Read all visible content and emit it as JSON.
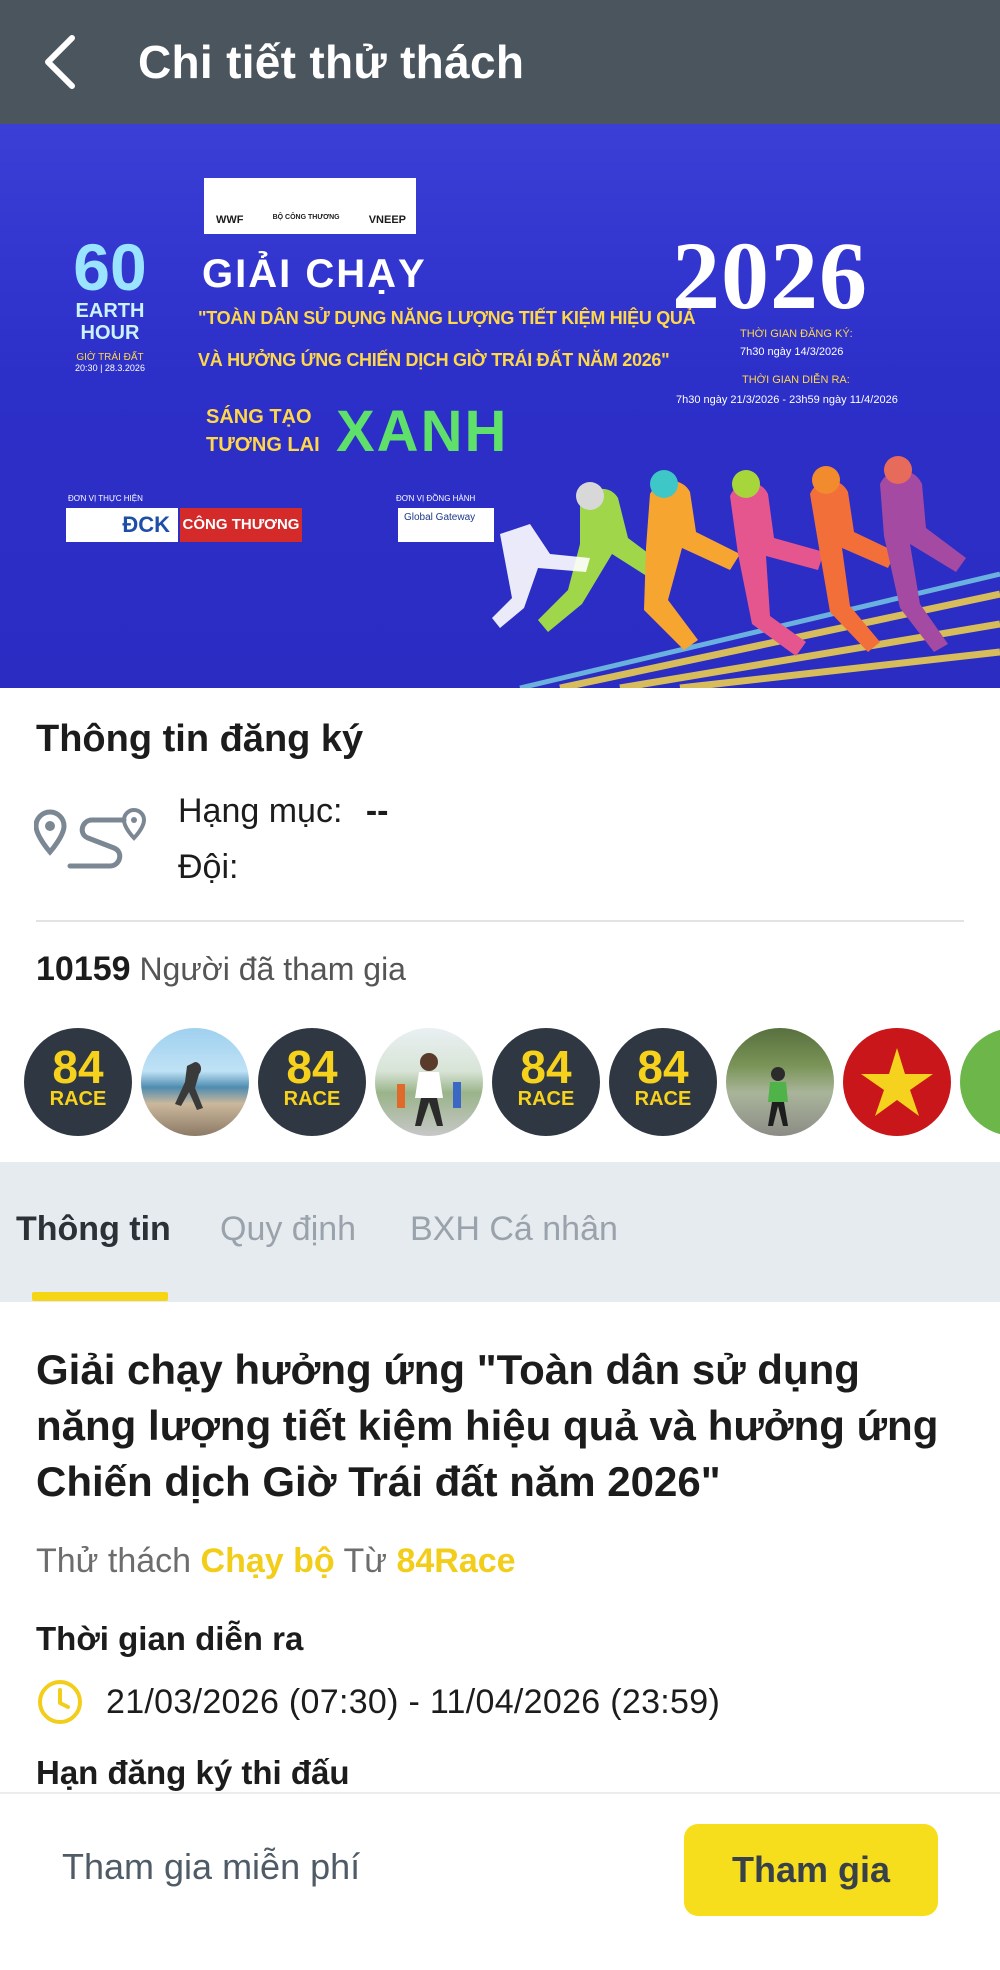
{
  "header": {
    "title": "Chi tiết thử thách",
    "back_icon": "chevron-left-icon"
  },
  "banner": {
    "partner_logos": [
      "WWF",
      "BỘ CÔNG THƯƠNG",
      "VNEEP"
    ],
    "earth_hour": {
      "number": "60",
      "line1": "EARTH",
      "line2": "HOUR",
      "vn_label": "GIỜ TRÁI ĐẤT",
      "date": "20:30 | 28.3.2026"
    },
    "heading": "GIẢI CHẠY",
    "slogan_line1": "\"TOÀN DÂN SỬ DỤNG NĂNG LƯỢNG TIẾT KIỆM HIỆU QUẢ",
    "slogan_line2": "VÀ HƯỞNG ỨNG CHIẾN DỊCH GIỜ TRÁI ĐẤT NĂM 2026\"",
    "tagline_small1": "SÁNG TẠO",
    "tagline_small2": "TƯƠNG LAI",
    "tagline_big": "XANH",
    "year": "2026",
    "reg_label": "THỜI GIAN ĐĂNG KÝ:",
    "reg_value": "7h30 ngày 14/3/2026",
    "run_label": "THỜI GIAN DIỄN RA:",
    "run_value": "7h30 ngày 21/3/2026 - 23h59 ngày 11/4/2026",
    "organizer_label": "ĐƠN VỊ THỰC HIỆN",
    "organizer1": "ĐCK",
    "organizer2": "CÔNG THƯƠNG",
    "companion_label": "ĐƠN VỊ ĐỒNG HÀNH",
    "companion": "Global Gateway"
  },
  "registration": {
    "title": "Thông tin đăng ký",
    "category_label": "Hạng mục:",
    "category_value": "--",
    "team_label": "Đội:",
    "route_icon": "route-pin-icon"
  },
  "participants": {
    "count": "10159",
    "label": "Người đã tham gia",
    "avatar_text_top": "84",
    "avatar_text_bottom": "RACE"
  },
  "tabs": [
    {
      "label": "Thông tin",
      "active": true
    },
    {
      "label": "Quy định",
      "active": false
    },
    {
      "label": "BXH Cá nhân",
      "active": false
    }
  ],
  "event": {
    "title": "Giải chạy hưởng ứng \"Toàn dân sử dụng năng lượng tiết kiệm hiệu quả và hưởng ứng Chiến dịch Giờ Trái đất năm 2026\"",
    "type_prefix": "Thử thách",
    "type_value": "Chạy bộ",
    "from_prefix": "Từ",
    "from_value": "84Race",
    "time_heading": "Thời gian diễn ra",
    "time_value": "21/03/2026 (07:30) - 11/04/2026 (23:59)",
    "deadline_heading": "Hạn đăng ký thi đấu"
  },
  "bottom": {
    "free_label": "Tham gia miễn phí",
    "join_label": "Tham gia"
  },
  "colors": {
    "header_bg": "#4b555d",
    "accent_yellow": "#f7de1c",
    "tab_bar_bg": "#e6ebf0",
    "banner_blue": "#2c2fc8"
  }
}
